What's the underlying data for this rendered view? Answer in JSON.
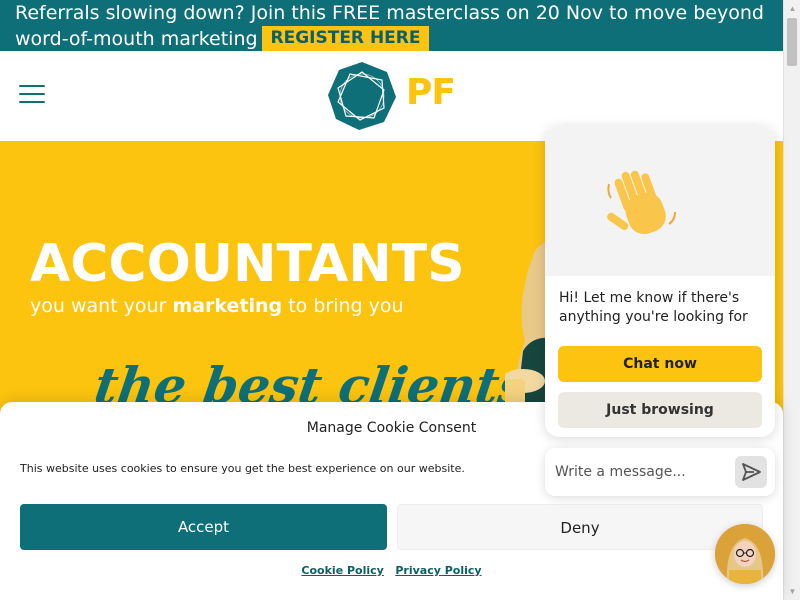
{
  "banner": {
    "line1": "Referrals slowing down? Join this FREE masterclass on 20 Nov to move beyond",
    "line2": "word-of-mouth marketing",
    "cta_label": "REGISTER HERE"
  },
  "header": {
    "logo_text": "PF",
    "menu_icon": "hamburger-icon"
  },
  "hero": {
    "title": "ACCOUNTANTS",
    "subtitle_before": "you want your ",
    "subtitle_bold": "marketing",
    "subtitle_after": " to bring you",
    "script_text": "the best clients"
  },
  "cookie": {
    "title": "Manage Cookie Consent",
    "text": "This website uses cookies to ensure you get the best experience on our website.",
    "accept_label": "Accept",
    "deny_label": "Deny",
    "links": {
      "cookie_policy": "Cookie Policy",
      "privacy_policy": "Privacy Policy"
    }
  },
  "chat": {
    "message": "Hi! Let me know if there's anything you're looking for",
    "primary_label": "Chat now",
    "secondary_label": "Just browsing",
    "input_placeholder": "Write a message...",
    "send_icon": "send-icon",
    "wave_icon": "waving-hand-icon"
  },
  "colors": {
    "brand_teal": "#0e6f78",
    "brand_yellow": "#fcc410"
  }
}
